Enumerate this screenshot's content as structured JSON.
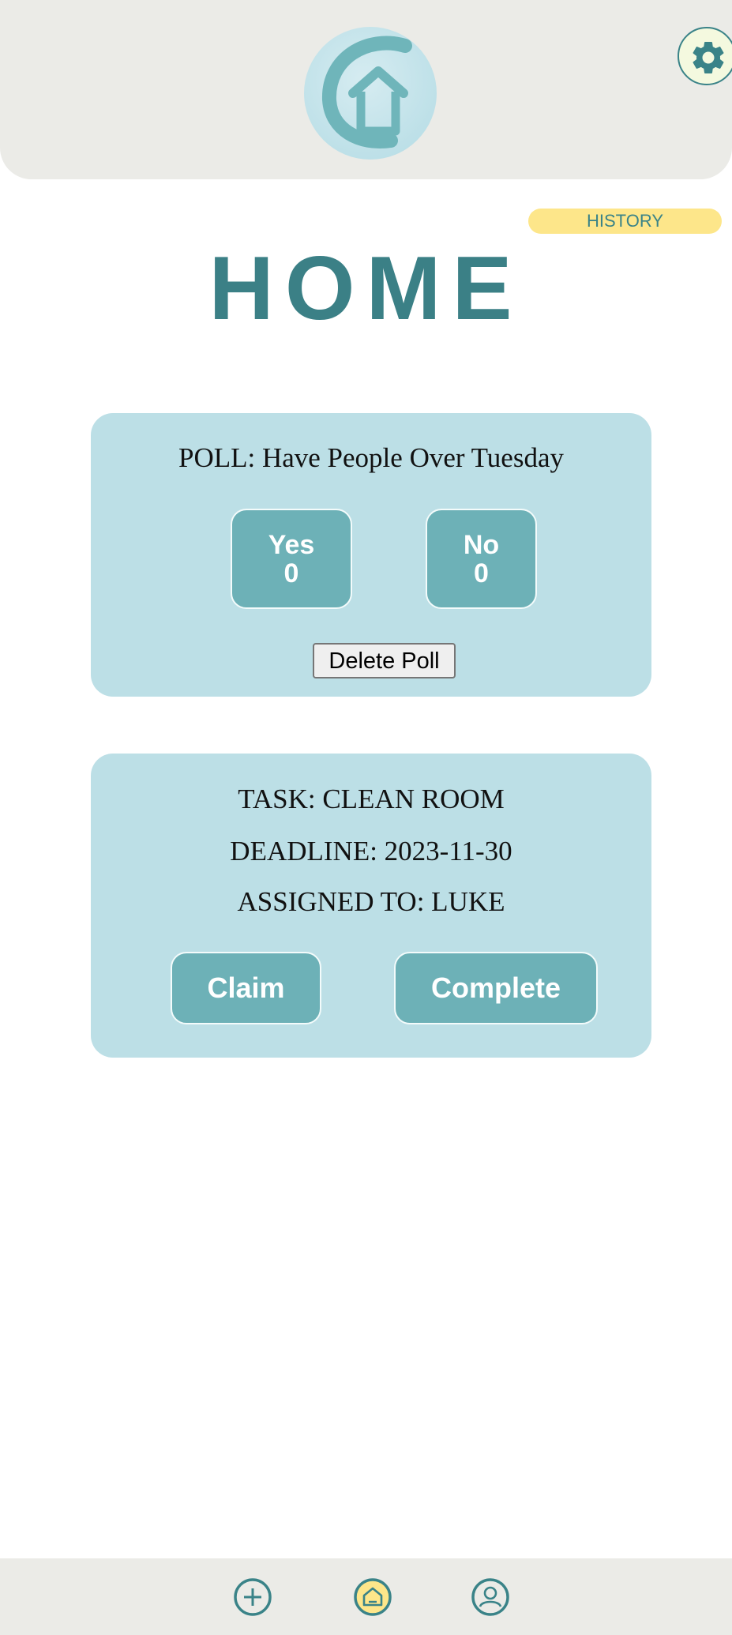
{
  "header": {
    "logo_icon": "house-logo-icon",
    "settings_icon": "gear-icon"
  },
  "history": {
    "label": "HISTORY"
  },
  "page": {
    "title": "HOME"
  },
  "poll": {
    "title": "POLL: Have People Over Tuesday",
    "options": [
      {
        "label": "Yes",
        "count": "0"
      },
      {
        "label": "No",
        "count": "0"
      }
    ],
    "delete_label": "Delete Poll"
  },
  "task": {
    "task_line": "TASK: CLEAN ROOM",
    "deadline_line": "DEADLINE: 2023-11-30",
    "assigned_line": "ASSIGNED TO: LUKE",
    "claim_label": "Claim",
    "complete_label": "Complete"
  },
  "nav": {
    "items": [
      {
        "icon": "plus-circle-icon"
      },
      {
        "icon": "home-icon",
        "active": true
      },
      {
        "icon": "user-icon"
      }
    ]
  },
  "colors": {
    "accent": "#3b8086",
    "card": "#bcdfe6",
    "button": "#6db1b7",
    "history": "#fde68a",
    "active_nav": "#fde68a"
  }
}
